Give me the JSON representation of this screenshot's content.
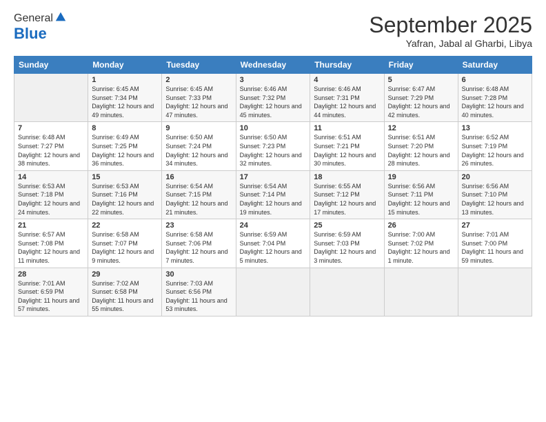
{
  "header": {
    "logo_general": "General",
    "logo_blue": "Blue",
    "month_title": "September 2025",
    "subtitle": "Yafran, Jabal al Gharbi, Libya"
  },
  "weekdays": [
    "Sunday",
    "Monday",
    "Tuesday",
    "Wednesday",
    "Thursday",
    "Friday",
    "Saturday"
  ],
  "weeks": [
    [
      {
        "day": "",
        "empty": true
      },
      {
        "day": "1",
        "sunrise": "Sunrise: 6:45 AM",
        "sunset": "Sunset: 7:34 PM",
        "daylight": "Daylight: 12 hours and 49 minutes."
      },
      {
        "day": "2",
        "sunrise": "Sunrise: 6:45 AM",
        "sunset": "Sunset: 7:33 PM",
        "daylight": "Daylight: 12 hours and 47 minutes."
      },
      {
        "day": "3",
        "sunrise": "Sunrise: 6:46 AM",
        "sunset": "Sunset: 7:32 PM",
        "daylight": "Daylight: 12 hours and 45 minutes."
      },
      {
        "day": "4",
        "sunrise": "Sunrise: 6:46 AM",
        "sunset": "Sunset: 7:31 PM",
        "daylight": "Daylight: 12 hours and 44 minutes."
      },
      {
        "day": "5",
        "sunrise": "Sunrise: 6:47 AM",
        "sunset": "Sunset: 7:29 PM",
        "daylight": "Daylight: 12 hours and 42 minutes."
      },
      {
        "day": "6",
        "sunrise": "Sunrise: 6:48 AM",
        "sunset": "Sunset: 7:28 PM",
        "daylight": "Daylight: 12 hours and 40 minutes."
      }
    ],
    [
      {
        "day": "7",
        "sunrise": "Sunrise: 6:48 AM",
        "sunset": "Sunset: 7:27 PM",
        "daylight": "Daylight: 12 hours and 38 minutes."
      },
      {
        "day": "8",
        "sunrise": "Sunrise: 6:49 AM",
        "sunset": "Sunset: 7:25 PM",
        "daylight": "Daylight: 12 hours and 36 minutes."
      },
      {
        "day": "9",
        "sunrise": "Sunrise: 6:50 AM",
        "sunset": "Sunset: 7:24 PM",
        "daylight": "Daylight: 12 hours and 34 minutes."
      },
      {
        "day": "10",
        "sunrise": "Sunrise: 6:50 AM",
        "sunset": "Sunset: 7:23 PM",
        "daylight": "Daylight: 12 hours and 32 minutes."
      },
      {
        "day": "11",
        "sunrise": "Sunrise: 6:51 AM",
        "sunset": "Sunset: 7:21 PM",
        "daylight": "Daylight: 12 hours and 30 minutes."
      },
      {
        "day": "12",
        "sunrise": "Sunrise: 6:51 AM",
        "sunset": "Sunset: 7:20 PM",
        "daylight": "Daylight: 12 hours and 28 minutes."
      },
      {
        "day": "13",
        "sunrise": "Sunrise: 6:52 AM",
        "sunset": "Sunset: 7:19 PM",
        "daylight": "Daylight: 12 hours and 26 minutes."
      }
    ],
    [
      {
        "day": "14",
        "sunrise": "Sunrise: 6:53 AM",
        "sunset": "Sunset: 7:18 PM",
        "daylight": "Daylight: 12 hours and 24 minutes."
      },
      {
        "day": "15",
        "sunrise": "Sunrise: 6:53 AM",
        "sunset": "Sunset: 7:16 PM",
        "daylight": "Daylight: 12 hours and 22 minutes."
      },
      {
        "day": "16",
        "sunrise": "Sunrise: 6:54 AM",
        "sunset": "Sunset: 7:15 PM",
        "daylight": "Daylight: 12 hours and 21 minutes."
      },
      {
        "day": "17",
        "sunrise": "Sunrise: 6:54 AM",
        "sunset": "Sunset: 7:14 PM",
        "daylight": "Daylight: 12 hours and 19 minutes."
      },
      {
        "day": "18",
        "sunrise": "Sunrise: 6:55 AM",
        "sunset": "Sunset: 7:12 PM",
        "daylight": "Daylight: 12 hours and 17 minutes."
      },
      {
        "day": "19",
        "sunrise": "Sunrise: 6:56 AM",
        "sunset": "Sunset: 7:11 PM",
        "daylight": "Daylight: 12 hours and 15 minutes."
      },
      {
        "day": "20",
        "sunrise": "Sunrise: 6:56 AM",
        "sunset": "Sunset: 7:10 PM",
        "daylight": "Daylight: 12 hours and 13 minutes."
      }
    ],
    [
      {
        "day": "21",
        "sunrise": "Sunrise: 6:57 AM",
        "sunset": "Sunset: 7:08 PM",
        "daylight": "Daylight: 12 hours and 11 minutes."
      },
      {
        "day": "22",
        "sunrise": "Sunrise: 6:58 AM",
        "sunset": "Sunset: 7:07 PM",
        "daylight": "Daylight: 12 hours and 9 minutes."
      },
      {
        "day": "23",
        "sunrise": "Sunrise: 6:58 AM",
        "sunset": "Sunset: 7:06 PM",
        "daylight": "Daylight: 12 hours and 7 minutes."
      },
      {
        "day": "24",
        "sunrise": "Sunrise: 6:59 AM",
        "sunset": "Sunset: 7:04 PM",
        "daylight": "Daylight: 12 hours and 5 minutes."
      },
      {
        "day": "25",
        "sunrise": "Sunrise: 6:59 AM",
        "sunset": "Sunset: 7:03 PM",
        "daylight": "Daylight: 12 hours and 3 minutes."
      },
      {
        "day": "26",
        "sunrise": "Sunrise: 7:00 AM",
        "sunset": "Sunset: 7:02 PM",
        "daylight": "Daylight: 12 hours and 1 minute."
      },
      {
        "day": "27",
        "sunrise": "Sunrise: 7:01 AM",
        "sunset": "Sunset: 7:00 PM",
        "daylight": "Daylight: 11 hours and 59 minutes."
      }
    ],
    [
      {
        "day": "28",
        "sunrise": "Sunrise: 7:01 AM",
        "sunset": "Sunset: 6:59 PM",
        "daylight": "Daylight: 11 hours and 57 minutes."
      },
      {
        "day": "29",
        "sunrise": "Sunrise: 7:02 AM",
        "sunset": "Sunset: 6:58 PM",
        "daylight": "Daylight: 11 hours and 55 minutes."
      },
      {
        "day": "30",
        "sunrise": "Sunrise: 7:03 AM",
        "sunset": "Sunset: 6:56 PM",
        "daylight": "Daylight: 11 hours and 53 minutes."
      },
      {
        "day": "",
        "empty": true
      },
      {
        "day": "",
        "empty": true
      },
      {
        "day": "",
        "empty": true
      },
      {
        "day": "",
        "empty": true
      }
    ]
  ]
}
